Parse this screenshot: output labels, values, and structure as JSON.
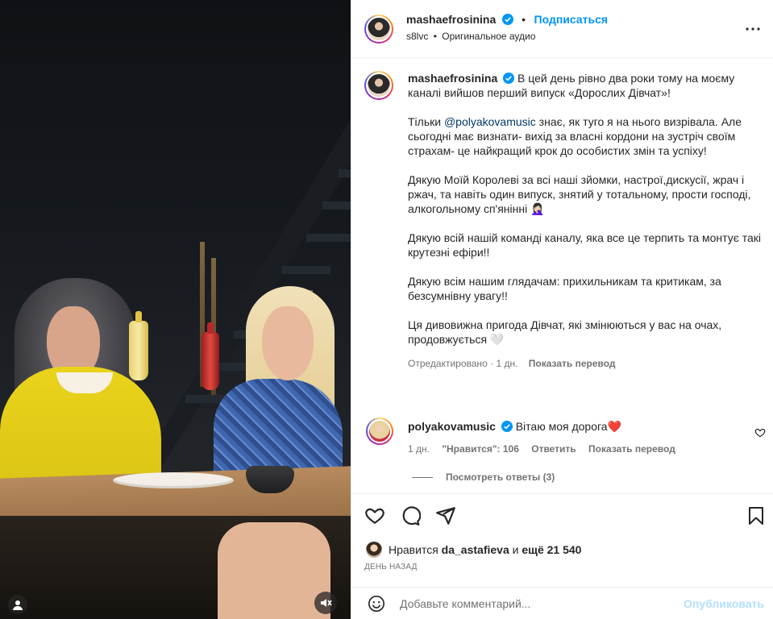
{
  "post": {
    "author": "mashaefrosinina",
    "follow_label": "Подписаться",
    "audio_user": "s8lvc",
    "audio_label": "Оригинальное аудио"
  },
  "caption": {
    "author": "mashaefrosinina",
    "p1": "В цей день рівно два роки тому на моєму каналі вийшов перший випуск «Дорослих Дівчат»!",
    "p2_prefix": "Тільки ",
    "p2_mention": "@polyakovamusic",
    "p2_rest": " знає, як туго я на нього визрівала. Але сьогодні має визнати- вихід за власні кордони на зустріч своїм страхам- це найкращий крок до особистих змін та успіху!",
    "p3": "Дякую Моїй Королеві за всі наші зйомки, настрої,дискусії, жрач і ржач, та навіть один випуск, знятий у тотальному, прости господі, алкогольному сп'янінні 🤦🏻‍♀️",
    "p4": "Дякую всій нашій команді каналу, яка все це терпить та монтує такі крутезні ефіри!!",
    "p5": "Дякую всім нашим глядачам: прихильникам та критикам, за безсумнівну увагу!!",
    "p6": "Ця дивовижна пригода Дівчат, які змінюються у вас на очах, продовжується 🤍",
    "edited": "Отредактировано",
    "time": "1 дн.",
    "translate": "Показать перевод"
  },
  "comment": {
    "author": "polyakovamusic",
    "text": "Вітаю моя дорога❤️",
    "time": "1 дн.",
    "likes": "\"Нравится\": 106",
    "reply": "Ответить",
    "translate": "Показать перевод",
    "view_replies": "Посмотреть ответы (3)"
  },
  "likes": {
    "prefix": "Нравится ",
    "user": "da_astafieva",
    "middle": " и ",
    "count": "ещё 21 540",
    "time": "ДЕНЬ НАЗАД"
  },
  "add_comment": {
    "placeholder": "Добавьте комментарий...",
    "publish": "Опубликовать"
  },
  "colors": {
    "link_blue": "#0095f6",
    "verified_blue": "#0095f6",
    "mention": "#00376b",
    "muted": "#737373"
  },
  "icons": [
    "more-icon",
    "verified-icon",
    "heart-icon",
    "comment-icon",
    "share-icon",
    "bookmark-icon",
    "emoji-icon",
    "mute-icon",
    "reels-icon"
  ]
}
